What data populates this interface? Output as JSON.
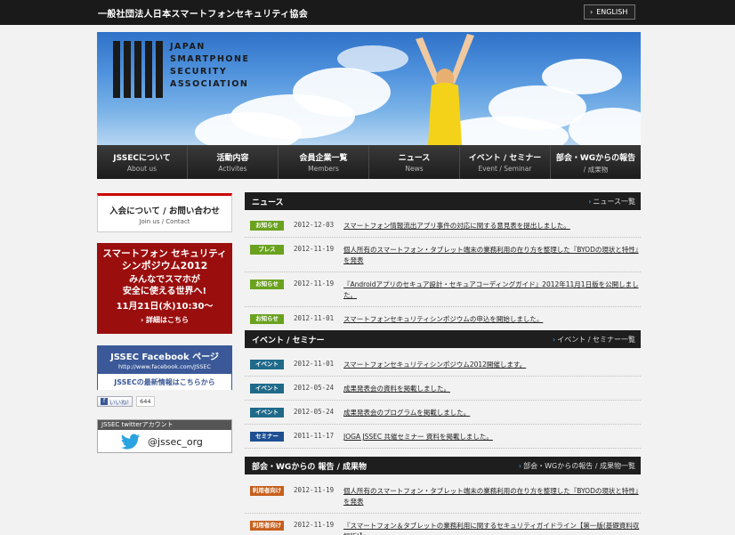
{
  "header": {
    "site_title": "一般社団法人日本スマートフォンセキュリティ協会",
    "lang_button": "ENGLISH"
  },
  "hero": {
    "logo_lines": [
      "JAPAN",
      "SMARTPHONE",
      "SECURITY",
      "ASSOCIATION"
    ]
  },
  "nav": [
    {
      "ja": "JSSECについて",
      "en": "About us"
    },
    {
      "ja": "活動内容",
      "en": "Activites"
    },
    {
      "ja": "会員企業一覧",
      "en": "Members"
    },
    {
      "ja": "ニュース",
      "en": "News"
    },
    {
      "ja": "イベント / セミナー",
      "en": "Event / Seminar"
    },
    {
      "ja": "部会・WGからの報告",
      "en": "/ 成果物"
    }
  ],
  "sidebar": {
    "contact": {
      "ja": "入会について / お問い合わせ",
      "en": "Join us / Contact"
    },
    "symposium": {
      "l1": "スマートフォン セキュリティ",
      "l2": "シンポジウム2012",
      "l3": "みんなでスマホが",
      "l4": "安全に使える世界へ!",
      "l5": "11月21日(水)10:30〜",
      "l6": "詳細はこちら"
    },
    "facebook": {
      "title": "JSSEC Facebook ページ",
      "url": "http://www.facebook.com/JSSEC",
      "cta": "JSSECの最新情報はこちらから"
    },
    "like": {
      "label": "いいね!",
      "count": "644"
    },
    "twitter": {
      "header": "JSSEC twitterアカウント",
      "handle": "@jssec_org"
    }
  },
  "news": {
    "title": "ニュース",
    "more": "ニュース一覧",
    "items": [
      {
        "badge": "お知らせ",
        "color": "green",
        "date": "2012-12-03",
        "title": "スマートフォン情報流出アプリ事件の対応に関する意見表を提出しました。"
      },
      {
        "badge": "プレス",
        "color": "green",
        "date": "2012-11-19",
        "title": "個人所有のスマートフォン・タブレット端末の業務利用の在り方を整理した『BYODの現状と特性』を発表"
      },
      {
        "badge": "お知らせ",
        "color": "green",
        "date": "2012-11-19",
        "title": "『Androidアプリのセキュア設計・セキュアコーディングガイド』2012年11月1日版を公開しました。"
      },
      {
        "badge": "お知らせ",
        "color": "green",
        "date": "2012-11-01",
        "title": "スマートフォンセキュリティシンポジウムの申込を開始しました。"
      }
    ]
  },
  "events": {
    "title": "イベント / セミナー",
    "more": "イベント / セミナー一覧",
    "items": [
      {
        "badge": "イベント",
        "color": "teal",
        "date": "2012-11-01",
        "title": "スマートフォンセキュリティシンポジウム2012開催します。"
      },
      {
        "badge": "イベント",
        "color": "teal",
        "date": "2012-05-24",
        "title": "成果発表会の資料を掲載しました。"
      },
      {
        "badge": "イベント",
        "color": "teal",
        "date": "2012-05-24",
        "title": "成果発表会のプログラムを掲載しました。"
      },
      {
        "badge": "セミナー",
        "color": "navy",
        "date": "2011-11-17",
        "title": "JOGA JSSEC 共催セミナー 資料を掲載しました。"
      }
    ]
  },
  "reports": {
    "title": "部会・WGからの 報告 / 成果物",
    "more": "部会・WGからの報告 / 成果物一覧",
    "items": [
      {
        "badge": "利用者向け",
        "color": "orange",
        "date": "2012-11-19",
        "title": "個人所有のスマートフォン・タブレット端末の業務利用の在り方を整理した『BYODの現状と特性』を発表"
      },
      {
        "badge": "利用者向け",
        "color": "orange",
        "date": "2012-11-19",
        "title": "『スマートフォン＆タブレットの業務利用に関するセキュリティガイドライン【第一版(基礎資料収録版)】』"
      }
    ]
  },
  "colors": {
    "green": "#6aa21e",
    "teal": "#1f6a8a",
    "navy": "#1d4f92",
    "orange": "#c65e1b",
    "accent_red": "#9b0e0e",
    "facebook": "#3b5998"
  }
}
